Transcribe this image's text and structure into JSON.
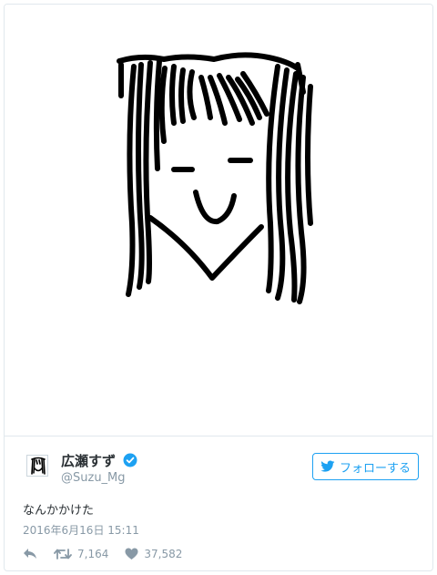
{
  "author": {
    "display_name": "広瀬すず",
    "screen_name": "@Suzu_Mg",
    "verified": true
  },
  "follow_button": {
    "label": "フォローする",
    "icon": "twitter-bird-icon"
  },
  "tweet": {
    "text": "なんかかけた",
    "timestamp": "2016年6月16日 15:11",
    "retweets": "7,164",
    "likes": "37,582"
  },
  "colors": {
    "accent": "#1da1f2",
    "secondary_text": "#8899a6",
    "border": "#e1e8ed"
  },
  "icons": [
    "reply-icon",
    "retweet-icon",
    "heart-icon",
    "verified-badge-icon"
  ]
}
